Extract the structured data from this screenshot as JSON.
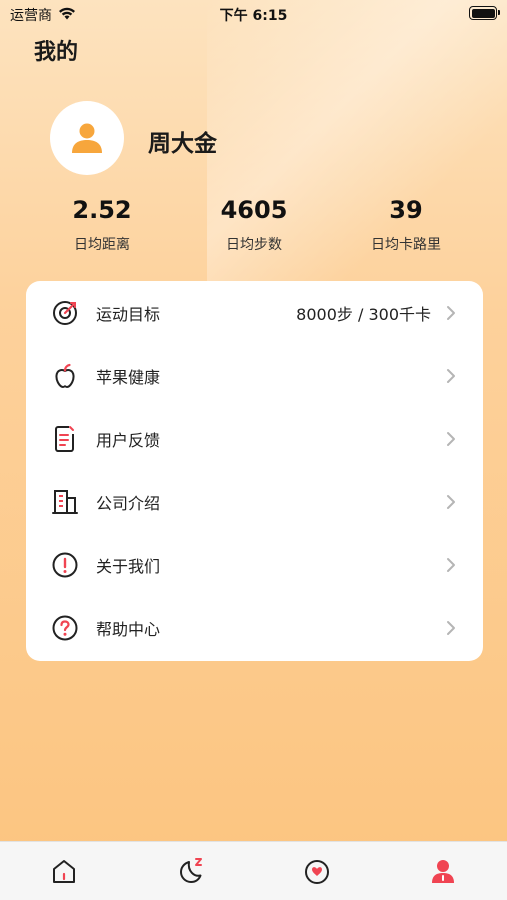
{
  "status_bar": {
    "carrier": "运营商",
    "time": "下午 6:15"
  },
  "page": {
    "title": "我的"
  },
  "profile": {
    "name": "周大金"
  },
  "stats": [
    {
      "value": "2.52",
      "label": "日均距离"
    },
    {
      "value": "4605",
      "label": "日均步数"
    },
    {
      "value": "39",
      "label": "日均卡路里"
    }
  ],
  "menu": {
    "items": [
      {
        "icon": "target-icon",
        "label": "运动目标",
        "value": "8000步 / 300千卡"
      },
      {
        "icon": "apple-icon",
        "label": "苹果健康",
        "value": ""
      },
      {
        "icon": "feedback-icon",
        "label": "用户反馈",
        "value": ""
      },
      {
        "icon": "building-icon",
        "label": "公司介绍",
        "value": ""
      },
      {
        "icon": "info-icon",
        "label": "关于我们",
        "value": ""
      },
      {
        "icon": "help-icon",
        "label": "帮助中心",
        "value": ""
      }
    ]
  },
  "tab_bar": {
    "tabs": [
      {
        "icon": "home-icon",
        "active": false
      },
      {
        "icon": "sleep-icon",
        "active": false
      },
      {
        "icon": "heart-icon",
        "active": false
      },
      {
        "icon": "profile-icon",
        "active": true
      }
    ]
  },
  "colors": {
    "accent": "#f04452",
    "avatar": "#f7a63c",
    "gradient_top": "#fde3bf",
    "gradient_bottom": "#fcc47f"
  }
}
